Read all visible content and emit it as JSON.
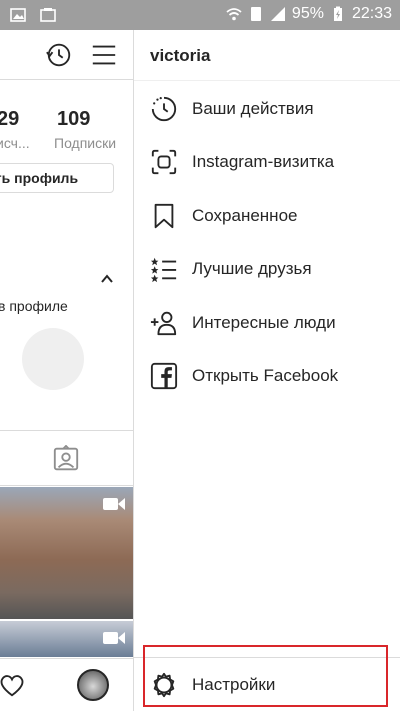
{
  "status_bar": {
    "battery": "95%",
    "time": "22:33"
  },
  "profile_bg": {
    "posts_count": "29",
    "followers_label": "исч...",
    "following_count": "109",
    "following_label": "Подписки",
    "edit_profile_label": "ать профиль",
    "suggestions_label": "в профиле"
  },
  "drawer": {
    "username": "victoria",
    "items": [
      {
        "label": "Ваши действия",
        "icon": "activity-clock-icon"
      },
      {
        "label": "Instagram-визитка",
        "icon": "nametag-scan-icon"
      },
      {
        "label": "Сохраненное",
        "icon": "bookmark-icon"
      },
      {
        "label": "Лучшие друзья",
        "icon": "close-friends-list-icon"
      },
      {
        "label": "Интересные люди",
        "icon": "discover-people-icon"
      },
      {
        "label": "Открыть Facebook",
        "icon": "facebook-icon"
      }
    ],
    "settings_label": "Настройки"
  },
  "colors": {
    "highlight": "#d9262a",
    "statusbar": "#9e9e9e"
  }
}
